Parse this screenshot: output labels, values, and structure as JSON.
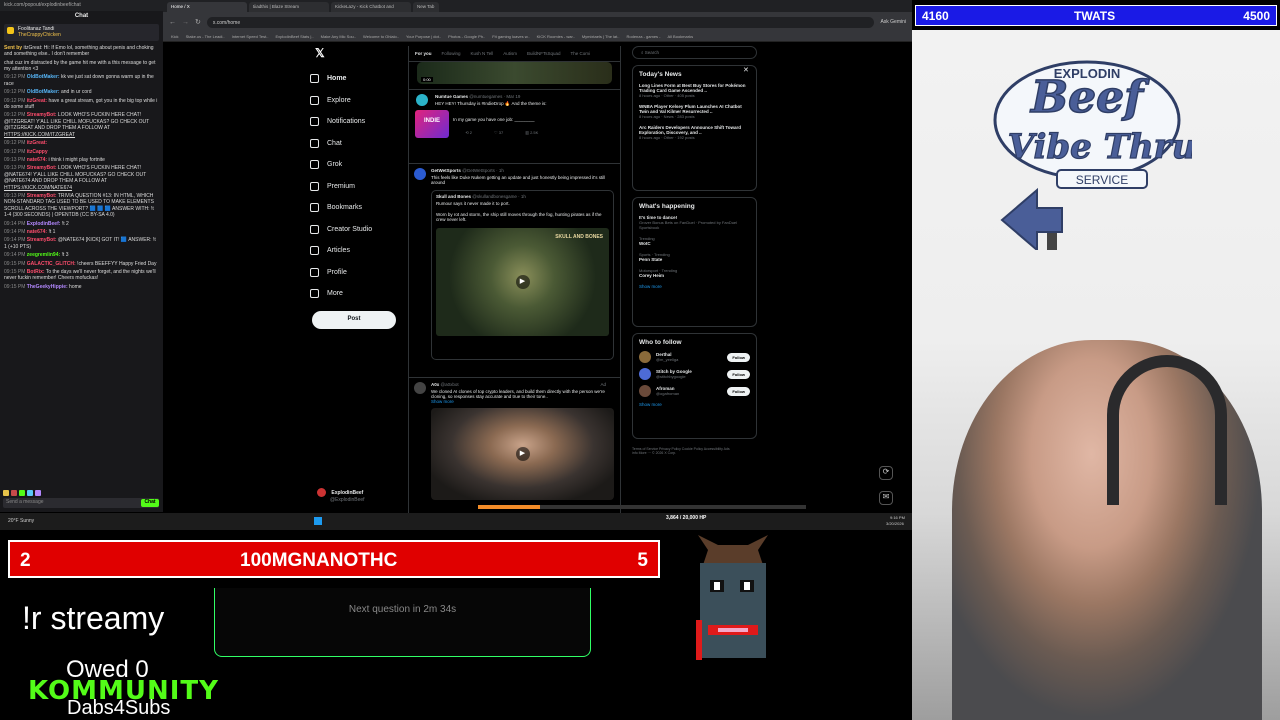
{
  "chat": {
    "url": "kick.com/popout/explodinbeef/chat",
    "header": "Chat",
    "pinned": {
      "line1": "Foolitanaz  Tandi",
      "line2": "TheCrappyChicken"
    },
    "messages": [
      {
        "time": "",
        "user": "Sent by",
        "color": "#f0c14b",
        "text": "itzGreat: Hi: If Emo lol, something about penis and choking and something else.. I don't remember"
      },
      {
        "time": "",
        "user": "",
        "color": "#ddd",
        "text": "chat cuz im distracted by the game hit me with a this message to get my attention <3"
      },
      {
        "time": "09:12 PM",
        "user": "OldBotMaker:",
        "color": "#56b4f5",
        "text": "kk we just sat down gonna warm up in the race"
      },
      {
        "time": "09:12 PM",
        "user": "OldBotMaker:",
        "color": "#56b4f5",
        "text": "and in ur cord"
      },
      {
        "time": "09:12 PM",
        "user": "itzGreat:",
        "color": "#ff4d6d",
        "text": "have a great stream, got you in the big top while i do some stuff"
      },
      {
        "time": "09:12 PM",
        "user": "StreamyBot:",
        "color": "#ff4d6d",
        "text": "LOOK WHO'S FUCKIN HERE CHAT! @ITZGREAT! Y'ALL LIKE CHILL MOFUCKAS? GO CHECK OUT @ITZGREAT AND DROP THEM A FOLLOW AT",
        "link": "HTTPS://KICK.COM/ITZGREAT"
      },
      {
        "time": "09:12 PM",
        "user": "itzGreat:",
        "color": "#ff4d6d",
        "text": ""
      },
      {
        "time": "09:12 PM",
        "user": "itzCappy",
        "color": "#ff4d6d",
        "text": ""
      },
      {
        "time": "09:13 PM",
        "user": "nate674:",
        "color": "#ff4d6d",
        "text": "i think i might play fortnite"
      },
      {
        "time": "09:13 PM",
        "user": "StreamyBot:",
        "color": "#ff4d6d",
        "text": "LOOK WHO'S FUCKIN HERE CHAT! @NATE674! Y'ALL LIKE CHILL MOFUCKAS? GO CHECK OUT @NATE674 AND DROP THEM A FOLLOW AT",
        "link": "HTTPS://KICK.COM/NATE674"
      },
      {
        "time": "09:13 PM",
        "user": "StreamyBot:",
        "color": "#ff4d6d",
        "text": "TRIVIA QUESTION #13: IN HTML, WHICH NON-STANDARD TAG USED TO BE USED TO MAKE ELEMENTS SCROLL ACROSS THE VIEWPORT? 🟦 🟦 🟦 ANSWER WITH: !t 1-4 (300 SECONDS) | OPENTDB (CC BY-SA 4.0)"
      },
      {
        "time": "09:14 PM",
        "user": "ExplodinBeef:",
        "color": "#b388ff",
        "text": "!t 2"
      },
      {
        "time": "09:14 PM",
        "user": "nate674:",
        "color": "#ff4d6d",
        "text": "!t 1"
      },
      {
        "time": "09:14 PM",
        "user": "StreamyBot:",
        "color": "#ff4d6d",
        "text": "@NATE674 [KICK] GOT IT! 🟦 ANSWER: !t 1 (+10 PTS)"
      },
      {
        "time": "09:14 PM",
        "user": "zeegremlin94:",
        "color": "#53fc18",
        "text": "!t 3"
      },
      {
        "time": "09:15 PM",
        "user": "GALACTIC_GLITCH:",
        "color": "#ff4d6d",
        "text": "!cheers BEEFFYY Happy Fried Day"
      },
      {
        "time": "09:15 PM",
        "user": "BotRix:",
        "color": "#ff4d6d",
        "text": "To the days we'll never forget, and the nights we'll never fuckin remember! Cheers mofuckas!"
      },
      {
        "time": "09:15 PM",
        "user": "TheGeekyHippie:",
        "color": "#b388ff",
        "text": "home"
      }
    ],
    "input_placeholder": "Send a message",
    "send_label": "Chat"
  },
  "browser": {
    "tabs": [
      "Home / X",
      "tiiadthis | Blaze Stream",
      "KickeLazy - Kick Chatbot and",
      "New Tab"
    ],
    "url": "x.com/home",
    "bookmarks": [
      "Kick",
      "Stake.us - The Leadi..",
      "Internet Speed Test..",
      "ExplodinBeef Stats |..",
      "Make Any Mic Sou..",
      "Welcome to Ohlalo..",
      "Your Purpose | dot..",
      "Photos - Google Ph..",
      "Fit gaming loaves w..",
      "KICK Roomies - war..",
      "Mymixtaels | The lat..",
      "Rodenza - games -",
      "All Bookmarks"
    ],
    "ask_gemini": "Ask Gemini"
  },
  "x": {
    "nav": [
      "Home",
      "Explore",
      "Notifications",
      "Chat",
      "Grok",
      "Premium",
      "Bookmarks",
      "Creator Studio",
      "Articles",
      "Profile",
      "More"
    ],
    "post_button": "Post",
    "account": {
      "name": "ExplodinBeef",
      "handle": "@ExplodinBeef"
    },
    "feed_tabs": [
      "For you",
      "Following",
      "Kush N Tell",
      "Autism",
      "BuildNFTsSquad",
      "The Comi"
    ],
    "video_time": "0:00",
    "posts": [
      {
        "name": "Numtue Games",
        "handle": "@numtuegames · Mar 19",
        "text": "HEY HEY! Thursday is #IndieDrop 🔥 And the theme is:",
        "sub": "In my game you have one job: ________",
        "stats": [
          "4",
          "2",
          "37",
          "2.5K"
        ]
      },
      {
        "name": "GetWetSports",
        "handle": "@GetWetSports · 1h",
        "text": "This feels like Duke Nukem getting an update and just honestly being impressed it's still around",
        "quote_name": "Skull and Bones",
        "quote_handle": "@skullandbonesgame · 1h",
        "quote_text": "Rumour says it never made it to port.",
        "quote_text2": "Worn by rot and storm, the ship still moves through the fog, hunting pirates as if the crew never left.",
        "game_title": "SKULL AND BONES"
      },
      {
        "name": "A0x",
        "handle": "@a0xbot",
        "badge": "Ad",
        "text": "We cloned AI clones of top crypto leaders, and build them directly with the person we're cloning, so responses stay accurate and true to their tone..",
        "more": "Show more"
      }
    ],
    "sidebar": {
      "search_placeholder": "Search",
      "news_title": "Today's News",
      "news": [
        {
          "title": "Long Lines Form at Best Buy Stores for Pokémon Trading Card Game Ascended ..",
          "meta": "8 hours ago · Other · 405 posts"
        },
        {
          "title": "WNBA Player Kelsey Plum Launches AI Chatbot Twin and Val Kilmer Resurrected ..",
          "meta": "8 hours ago · News · 283 posts"
        },
        {
          "title": "Arc Raiders Developers Announce Shift Toward Exploration, Discovery, and ..",
          "meta": "8 hours ago · Other · 192 posts"
        }
      ],
      "happening_title": "What's happening",
      "trends": [
        {
          "meta": "",
          "name": "It's time to dance!",
          "sub": "Grover Bonus Bets on FanDuel · Promoted by FanDuel Sportsbook"
        },
        {
          "meta": "Trending",
          "name": "WotC",
          "sub": ""
        },
        {
          "meta": "Sports · Trending",
          "name": "Penn State",
          "sub": ""
        },
        {
          "meta": "Motorsport · Trending",
          "name": "Corey Heim",
          "sub": ""
        }
      ],
      "show_more": "Show more",
      "follow_title": "Who to follow",
      "follow": [
        {
          "name": "Derthal",
          "handle": "@m_yeeliga",
          "color": "#8a6a3a"
        },
        {
          "name": "Stitch by Google",
          "handle": "@stitchbygoogle",
          "color": "#4d6bd6"
        },
        {
          "name": "Afroman",
          "handle": "@ogafroman",
          "color": "#6a4a3a"
        }
      ],
      "follow_btn": "Follow",
      "footer": "Terms of Service   Privacy Policy   Cookie Policy   Accessibility   Ads info   More ···   © 2026 X Corp."
    }
  },
  "taskbar": {
    "weather": "20°F  Sunny",
    "hp": "3,864 / 20,000 HP",
    "time": "9:16 PM",
    "date": "3/20/2026"
  },
  "overlay": {
    "score_left": "4160",
    "score_title": "TWATS",
    "score_right": "4500",
    "red_left": "2",
    "red_title": "100MGNANOTHC",
    "red_right": "5",
    "streamy": "!r streamy",
    "next_question": "Next question in 2m 34s",
    "owed": "Owed 0",
    "kommunity": "KOMMUNITY",
    "dabs": "Dabs4Subs",
    "sign_line1": "EXPLODIN",
    "sign_line2": "Beef",
    "sign_line3": "Vibe Thru",
    "sign_line4": "SERVICE"
  },
  "colors": {
    "kick_green": "#53fc18",
    "x_blue": "#1d9bf0",
    "score_blue": "#1a1ae6",
    "alert_red": "#e00000"
  }
}
